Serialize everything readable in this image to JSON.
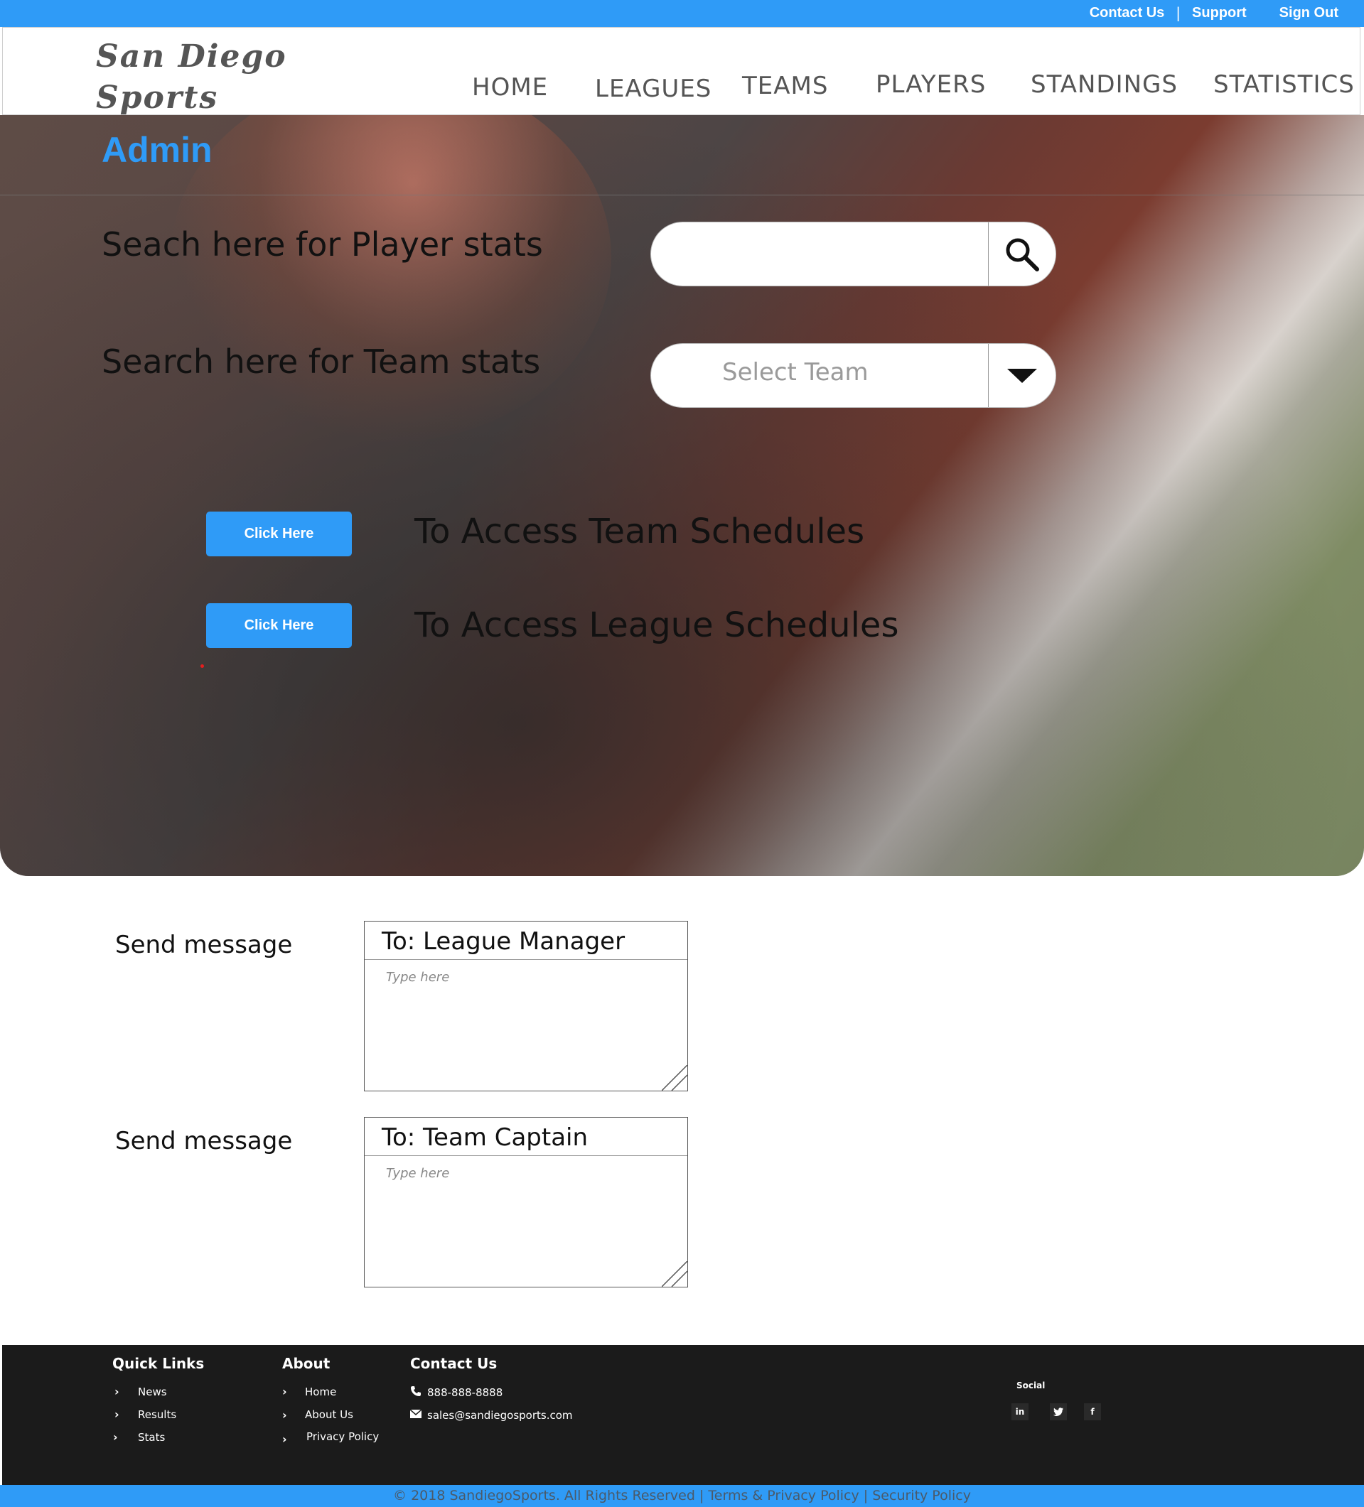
{
  "topbar": {
    "contact_label": "Contact Us",
    "separator": "|",
    "support_label": "Support",
    "signout_label": "Sign Out"
  },
  "header": {
    "logo_line1": "San Diego",
    "logo_line2": "Sports",
    "nav": [
      "HOME",
      "LEAGUES",
      "TEAMS",
      "PLAYERS",
      "STANDINGS",
      "STATISTICS"
    ]
  },
  "admin": {
    "title": "Admin",
    "player_search_label": "Seach here for Player stats",
    "team_search_label": "Search here for Team stats",
    "team_select_placeholder": "Select Team",
    "team_schedules_button": "Click Here",
    "team_schedules_text": "To Access Team Schedules",
    "league_schedules_button": "Click Here",
    "league_schedules_text": "To Access League Schedules"
  },
  "messages": [
    {
      "label": "Send message",
      "to": "To: League Manager",
      "placeholder": "Type here"
    },
    {
      "label": "Send message",
      "to": "To: Team Captain",
      "placeholder": "Type here"
    }
  ],
  "footer": {
    "quick_links_title": "Quick Links",
    "quick_links": [
      "News",
      "Results",
      "Stats"
    ],
    "about_title": "About",
    "about_links": [
      "Home",
      "About Us",
      "Privacy Policy"
    ],
    "contact_title": "Contact Us",
    "phone": "888-888-8888",
    "email": "sales@sandiegosports.com",
    "social_title": "Social",
    "social": [
      "in",
      "twitter",
      "f"
    ],
    "copyright": "© 2018 SandiegoSports. All Rights Reserved |",
    "terms": "Terms & Privacy Policy",
    "sep": "|",
    "security": "Security Policy"
  },
  "colors": {
    "accent": "#2f9bf7",
    "footer_bg": "#1b1b1b"
  },
  "icons": [
    "search-icon",
    "caret-down-icon",
    "chevron-right-icon",
    "phone-icon",
    "mail-icon",
    "linkedin-icon",
    "twitter-icon",
    "facebook-icon"
  ]
}
